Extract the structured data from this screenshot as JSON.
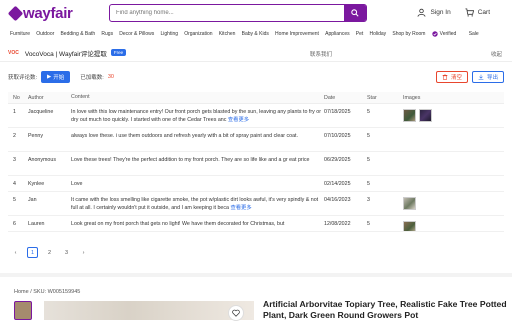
{
  "header": {
    "logo_text": "wayfair",
    "search_placeholder": "Find anything home...",
    "sign_in": "Sign In",
    "cart": "Cart"
  },
  "categories": [
    "Furniture",
    "Outdoor",
    "Bedding & Bath",
    "Rugs",
    "Decor & Pillows",
    "Lighting",
    "Organization",
    "Kitchen",
    "Baby & Kids",
    "Home Improvement",
    "Appliances",
    "Pet",
    "Holiday",
    "Shop by Room",
    "Verified",
    "Sale"
  ],
  "extension": {
    "logo": "VOC",
    "title": "VocoVoca | Wayfair评论提取",
    "badge": "Free",
    "contact": "联系我们",
    "collapse": "收起",
    "fetch_label": "获取评论数:",
    "start_button": "开始",
    "fetched_label": "已加载数:",
    "fetched_count": "30",
    "clear_button": "清空",
    "export_button": "导出"
  },
  "table": {
    "headers": [
      "No",
      "Author",
      "Content",
      "Date",
      "Star",
      "Images"
    ],
    "rows": [
      {
        "no": "1",
        "author": "Jacqueline",
        "content": "In love with this low maintenance entry! Our front porch gets blasted by the sun, leaving any plants to fry or dry out much too quickly. I started with one of the Cedar Trees anc",
        "more": "查看更多",
        "date": "07/18/2025",
        "star": "5",
        "images": 2
      },
      {
        "no": "2",
        "author": "Penny",
        "content": "always love these. i use them outdoors and refresh yearly with a bit of spray paint and clear coat.",
        "more": "",
        "date": "07/10/2025",
        "star": "5",
        "images": 0
      },
      {
        "no": "3",
        "author": "Anonymous",
        "content": "Love these trees! They're the perfect addition to my front porch. They are so life like and a gr eat price",
        "more": "",
        "date": "06/29/2025",
        "star": "5",
        "images": 0
      },
      {
        "no": "4",
        "author": "Kynlee",
        "content": "Love",
        "more": "",
        "date": "02/14/2025",
        "star": "5",
        "images": 0
      },
      {
        "no": "5",
        "author": "Jan",
        "content": "It came with the loss smelling like cigarette smoke, the pot w/plastic dirt looks awful, it's very spindly & not full at all. I certainly wouldn't put it outside, and I am keeping it beca",
        "more": "查看更多",
        "date": "04/16/2023",
        "star": "3",
        "images": 1
      },
      {
        "no": "6",
        "author": "Lauren",
        "content": "Look great on my front porch that gets no light! We have them decorated for Christmas, but",
        "more": "",
        "date": "12/08/2022",
        "star": "5",
        "images": 1
      }
    ]
  },
  "pagination": {
    "pages": [
      "1",
      "2",
      "3"
    ],
    "active": "1"
  },
  "product": {
    "breadcrumb": "Home  /  SKU: W005159945",
    "title": "Artificial Arborvitae Topiary Tree, Realistic Fake Tree Potted Plant, Dark Green Round Growers Pot"
  },
  "colors": {
    "brand": "#7b189f",
    "accent": "#2b6de8",
    "danger": "#e8462e"
  }
}
